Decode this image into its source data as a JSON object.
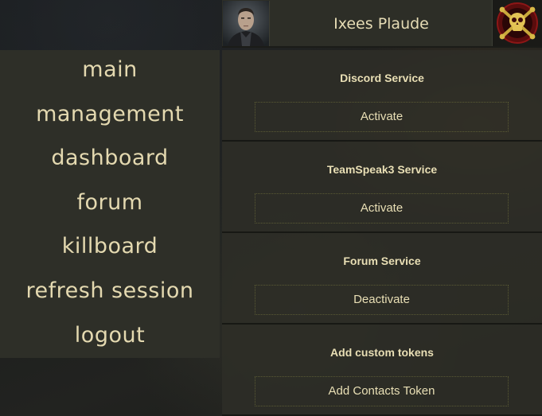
{
  "header": {
    "character_name": "Ixees Plaude"
  },
  "sidebar": {
    "items": [
      {
        "label": "main"
      },
      {
        "label": "management"
      },
      {
        "label": "dashboard"
      },
      {
        "label": "forum"
      },
      {
        "label": "killboard"
      },
      {
        "label": "refresh session"
      },
      {
        "label": "logout"
      }
    ]
  },
  "services": [
    {
      "title": "Discord Service",
      "button": "Activate"
    },
    {
      "title": "TeamSpeak3 Service",
      "button": "Activate"
    },
    {
      "title": "Forum Service",
      "button": "Deactivate"
    },
    {
      "title": "Add custom tokens",
      "button": "Add Contacts Token"
    }
  ],
  "colors": {
    "text": "#e8ddb3",
    "panel": "#2d2e27",
    "button_border": "#5a5a34"
  }
}
